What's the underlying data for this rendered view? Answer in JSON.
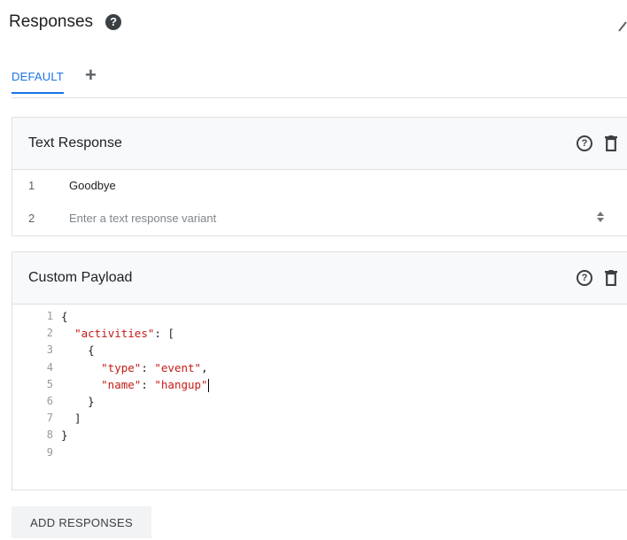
{
  "header": {
    "title": "Responses",
    "help_glyph": "?"
  },
  "tabs": {
    "default_label": "DEFAULT",
    "add_glyph": "+"
  },
  "text_response": {
    "title": "Text Response",
    "rows": [
      {
        "num": "1",
        "text": "Goodbye"
      },
      {
        "num": "2",
        "placeholder": "Enter a text response variant"
      }
    ]
  },
  "custom_payload": {
    "title": "Custom Payload",
    "line_numbers": [
      "1",
      "2",
      "3",
      "4",
      "5",
      "6",
      "7",
      "8",
      "9"
    ],
    "code": {
      "l1": "{",
      "l2_key": "\"activities\"",
      "l2_rest": ": [",
      "l3": "    {",
      "l4_key": "\"type\"",
      "l4_sep": ": ",
      "l4_val": "\"event\"",
      "l4_end": ",",
      "l5_key": "\"name\"",
      "l5_sep": ": ",
      "l5_val": "\"hangup\"",
      "l6": "    }",
      "l7": "  ]",
      "l8": "}",
      "l9": ""
    }
  },
  "actions": {
    "add_responses_label": "ADD RESPONSES"
  },
  "icons": {
    "help": "help-circle-icon",
    "delete": "trash-icon",
    "add": "plus-icon",
    "edit": "pencil-icon",
    "spinner": "updown-icon"
  },
  "colors": {
    "accent": "#1a73e8",
    "string": "#c41a16"
  }
}
